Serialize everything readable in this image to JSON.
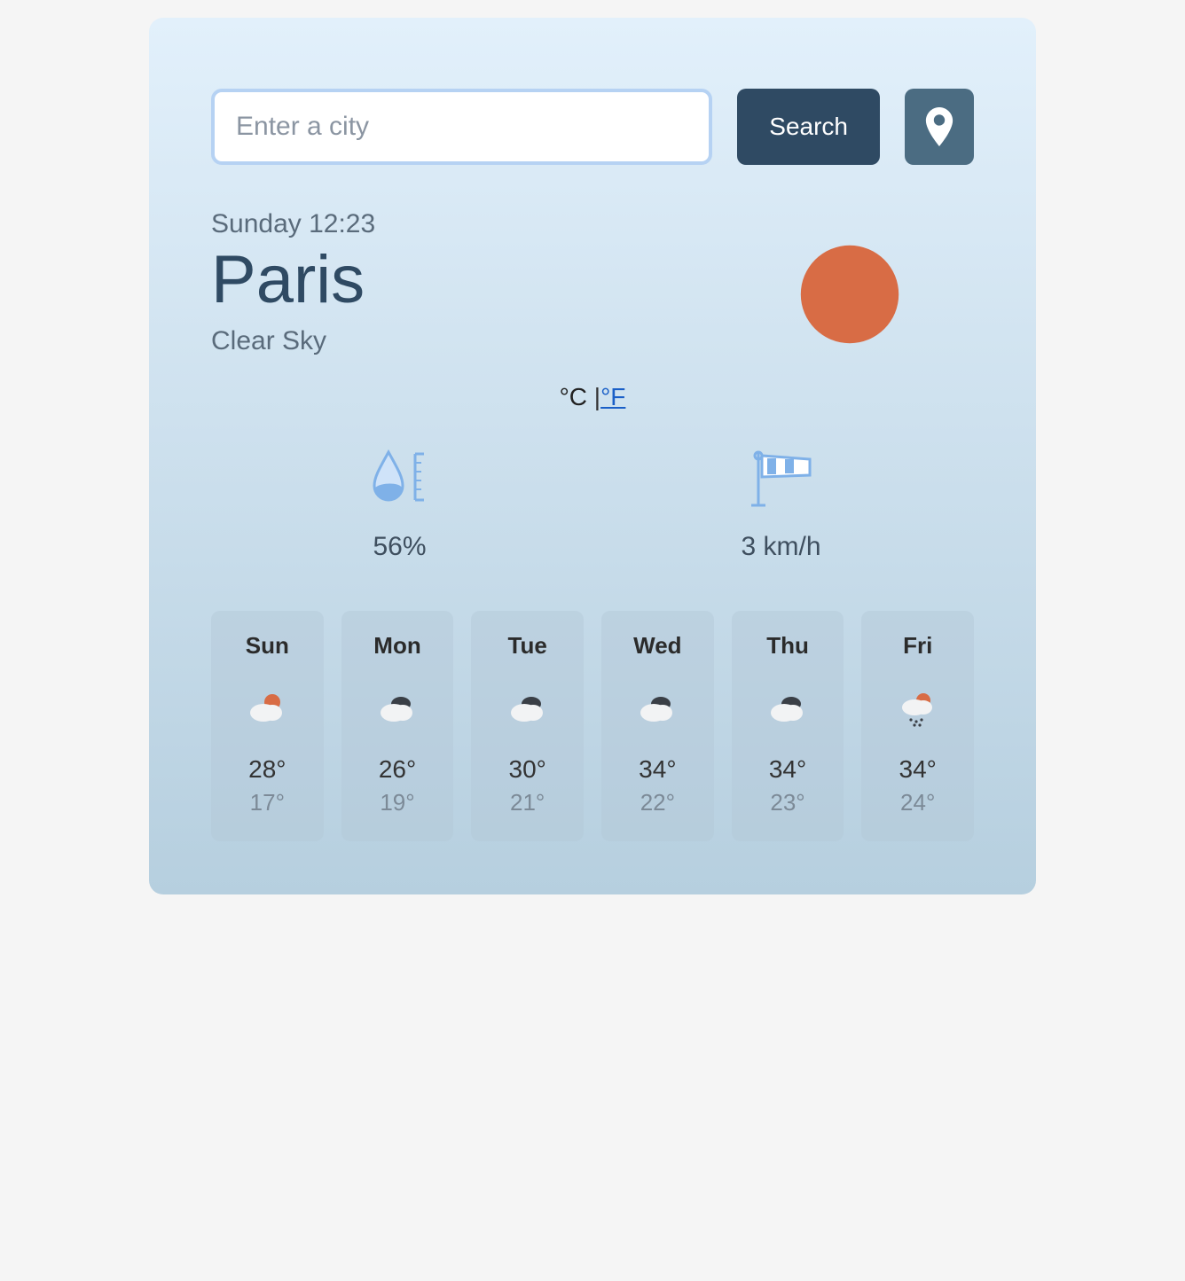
{
  "search": {
    "placeholder": "Enter a city",
    "button_label": "Search"
  },
  "current": {
    "datetime": "Sunday 12:23",
    "city": "Paris",
    "condition": "Clear Sky",
    "humidity": "56%",
    "wind": "3 km/h"
  },
  "units": {
    "celsius": "°C",
    "separator": " |",
    "fahrenheit": "°F"
  },
  "forecast": [
    {
      "day": "Sun",
      "icon": "partly-sunny",
      "hi": "28°",
      "lo": "17°"
    },
    {
      "day": "Mon",
      "icon": "cloudy",
      "hi": "26°",
      "lo": "19°"
    },
    {
      "day": "Tue",
      "icon": "cloudy",
      "hi": "30°",
      "lo": "21°"
    },
    {
      "day": "Wed",
      "icon": "cloudy",
      "hi": "34°",
      "lo": "22°"
    },
    {
      "day": "Thu",
      "icon": "cloudy",
      "hi": "34°",
      "lo": "23°"
    },
    {
      "day": "Fri",
      "icon": "rain",
      "hi": "34°",
      "lo": "24°"
    }
  ],
  "colors": {
    "sun": "#d86c45",
    "cloud_dark": "#3a3f46",
    "cloud_light": "#f2f3f4",
    "accent_blue": "#7fb1e8"
  }
}
